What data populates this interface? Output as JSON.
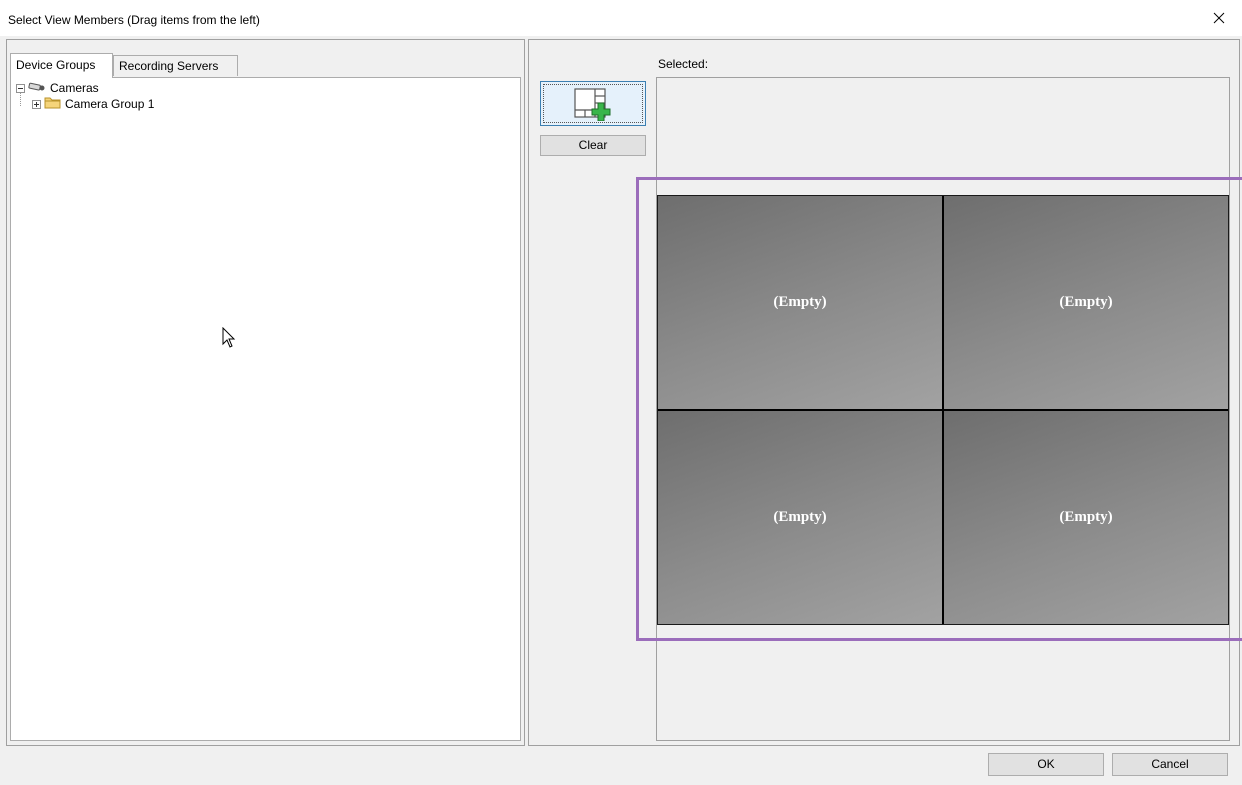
{
  "window": {
    "title": "Select View Members (Drag items from the left)",
    "close_icon": "close-icon"
  },
  "tabs": [
    {
      "label": "Device Groups",
      "active": true
    },
    {
      "label": "Recording Servers",
      "active": false
    }
  ],
  "tree": {
    "root": {
      "label": "Cameras",
      "icon": "camera-icon",
      "expanded": true
    },
    "children": [
      {
        "label": "Camera Group 1",
        "icon": "folder-icon",
        "expanded": false
      }
    ]
  },
  "toolbar": {
    "add_icon": "add-layout-icon",
    "clear_label": "Clear"
  },
  "view": {
    "selected_label": "Selected:",
    "cells": [
      "(Empty)",
      "(Empty)",
      "(Empty)",
      "(Empty)"
    ]
  },
  "footer": {
    "ok_label": "OK",
    "cancel_label": "Cancel"
  },
  "colors": {
    "highlight": "#9b6dbb",
    "dialog_bg": "#f0f0f0",
    "cell_bg": "#8a8a8a"
  }
}
